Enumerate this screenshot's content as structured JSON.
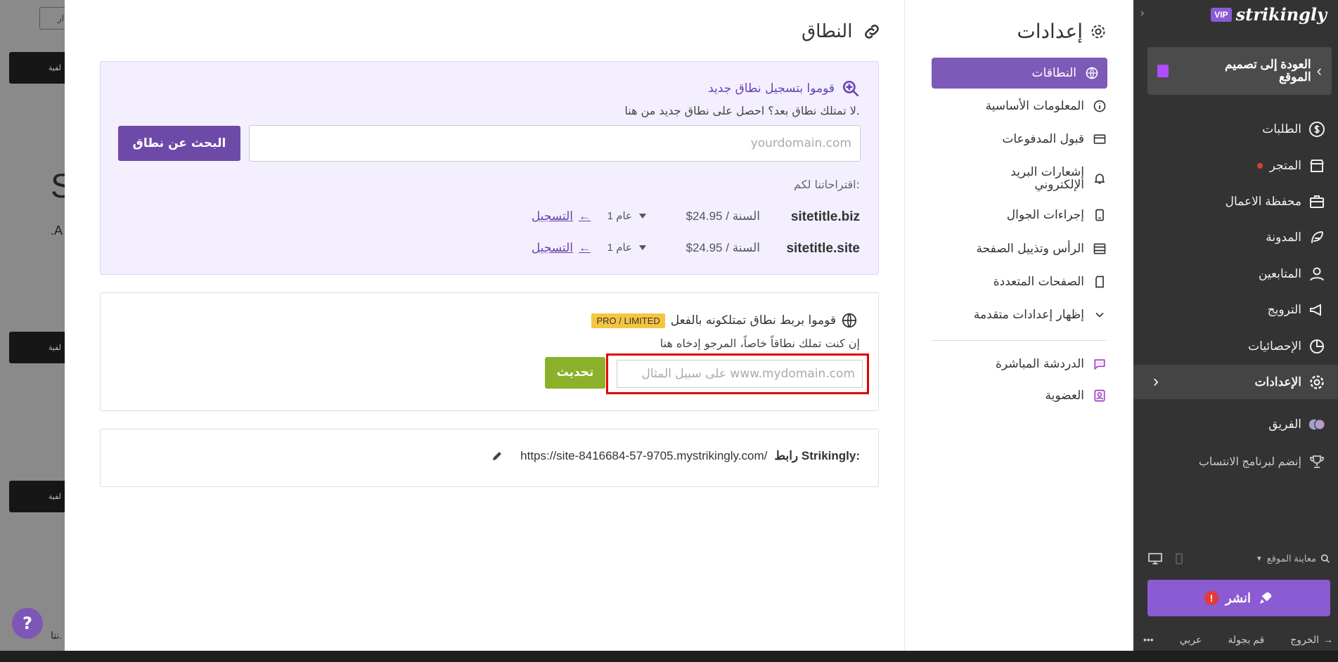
{
  "background": {
    "search_fragment": "ار",
    "big_letter_s": "S",
    "big_letter_a": ".A",
    "bottom_fragment": "نتا.",
    "block_labels": [
      "لفية",
      "لفية",
      "لفية"
    ]
  },
  "help_label": "?",
  "app_sidebar": {
    "logo_badge": "VIP",
    "logo_text": "strikingly",
    "back_label": "العودة إلى تصميم الموقع",
    "items": [
      {
        "label": "الطلبات",
        "icon": "dollar-icon"
      },
      {
        "label": "المتجر",
        "icon": "store-icon"
      },
      {
        "label": "محفظة الاعمال",
        "icon": "briefcase-icon"
      },
      {
        "label": "المدونة",
        "icon": "feather-icon"
      },
      {
        "label": "المتابعين",
        "icon": "users-icon"
      },
      {
        "label": "الترويج",
        "icon": "megaphone-icon"
      },
      {
        "label": "الإحصائيات",
        "icon": "pie-chart-icon"
      },
      {
        "label": "الإعدادات",
        "icon": "gear-icon"
      },
      {
        "label": "الفريق",
        "icon": "team-avatar-icon"
      },
      {
        "label": "إنضم لبرنامج الانتساب",
        "icon": "trophy-icon"
      }
    ],
    "preview_label": "معاينة الموقع",
    "publish_label": "انشر",
    "publish_warning": "!",
    "bottom": {
      "logout": "الخروج",
      "tour": "قم بجولة",
      "language": "عربي",
      "more": "•••"
    }
  },
  "settings": {
    "title": "إعدادات",
    "items": [
      {
        "label": "النطاقات",
        "icon": "globe-icon"
      },
      {
        "label": "المعلومات الأساسية",
        "icon": "info-icon"
      },
      {
        "label": "قبول المدفوعات",
        "icon": "card-icon"
      },
      {
        "label": "إشعارات البريد الإلكتروني",
        "icon": "bell-icon"
      },
      {
        "label": "إجراءات الجوال",
        "icon": "mobile-icon"
      },
      {
        "label": "الرأس وتذييل الصفحة",
        "icon": "layout-icon"
      },
      {
        "label": "الصفحات المتعددة",
        "icon": "pages-icon"
      },
      {
        "label": "إظهار إعدادات متقدمة",
        "icon": "chevron-down-icon"
      },
      {
        "label": "الدردشة المباشرة",
        "icon": "chat-icon"
      },
      {
        "label": "العضوية",
        "icon": "member-icon"
      }
    ]
  },
  "domain": {
    "title": "النطاق",
    "register": {
      "title": "قوموا بتسجيل نطاق جديد",
      "subtitle": "لا تمتلك نطاق بعد؟ احصل على نطاق جديد من هنا.",
      "placeholder": "yourdomain.com",
      "search_button": "البحث عن نطاق",
      "suggestions_label": "اقتراحاتنا لكم:",
      "suggestions": [
        {
          "domain": "sitetitle.biz",
          "price": "$24.95 / السنة",
          "years": "1 عام",
          "register": "التسجيل"
        },
        {
          "domain": "sitetitle.site",
          "price": "$24.95 / السنة",
          "years": "1 عام",
          "register": "التسجيل"
        }
      ]
    },
    "own": {
      "title": "قوموا بربط نطاق تمتلكونه بالفعل",
      "badge": "PRO / LIMITED",
      "subtitle": "إن كنت تملك نطاقاً خاصاً، المرجو إدخاه هنا",
      "placeholder": "على سبيل المثال www.mydomain.com",
      "update_button": "تحديث"
    },
    "link": {
      "label": "رابط Strikingly:",
      "url": "https://site-8416684-57-9705.mystrikingly.com/"
    }
  }
}
